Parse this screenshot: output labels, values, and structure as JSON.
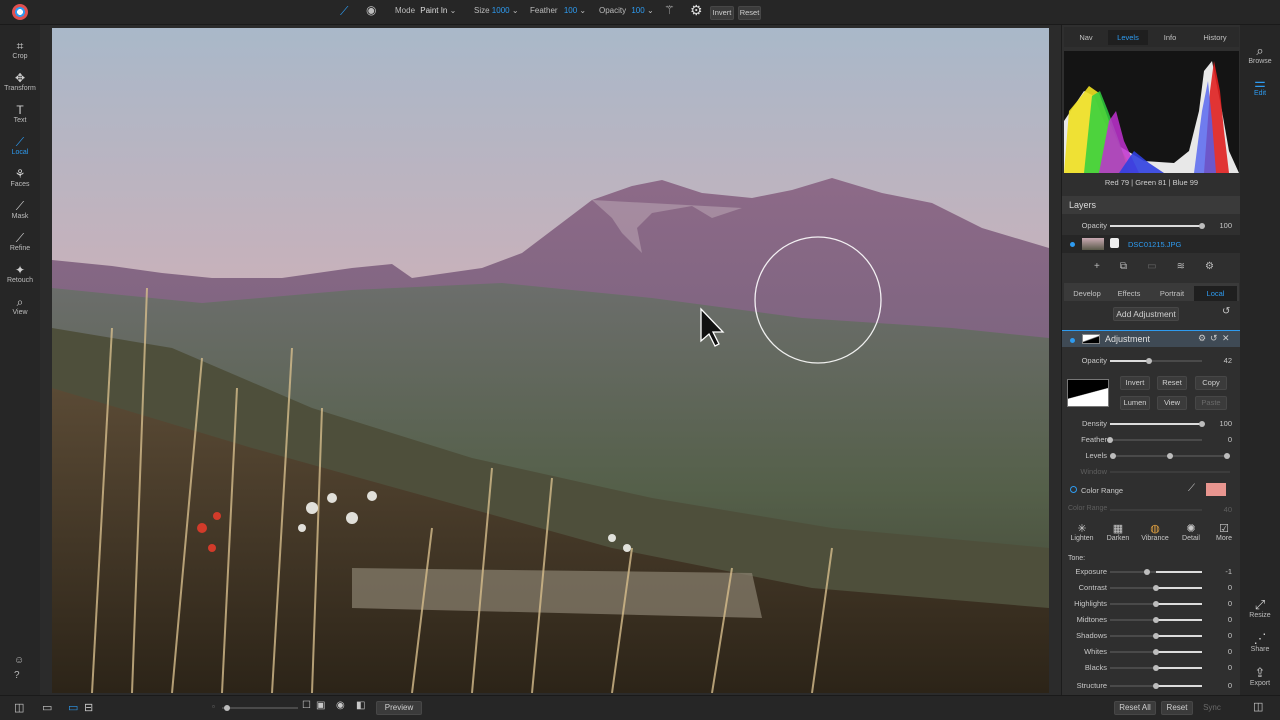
{
  "toolbar": {
    "mode_label": "Mode",
    "mode_value": "Paint In",
    "size_label": "Size",
    "size_value": "1000",
    "feather_label": "Feather",
    "feather_value": "100",
    "opacity_label": "Opacity",
    "opacity_value": "100",
    "invert": "Invert",
    "reset": "Reset"
  },
  "left_tools": [
    {
      "label": "Crop",
      "icon": "crop-icon"
    },
    {
      "label": "Transform",
      "icon": "transform-icon"
    },
    {
      "label": "Text",
      "icon": "text-icon"
    },
    {
      "label": "Local",
      "icon": "brush-icon"
    },
    {
      "label": "Faces",
      "icon": "faces-icon"
    },
    {
      "label": "Mask",
      "icon": "mask-icon"
    },
    {
      "label": "Refine",
      "icon": "refine-icon"
    },
    {
      "label": "Retouch",
      "icon": "retouch-icon"
    },
    {
      "label": "View",
      "icon": "zoom-icon"
    }
  ],
  "right_tools": {
    "browse": "Browse",
    "edit": "Edit",
    "resize": "Resize",
    "share": "Share",
    "export": "Export"
  },
  "panel": {
    "tabs": [
      "Nav",
      "Levels",
      "Info",
      "History"
    ],
    "histogram_readout": {
      "red_label": "Red",
      "red": "79",
      "green_label": "Green",
      "green": "81",
      "blue_label": "Blue",
      "blue": "99"
    },
    "layers_title": "Layers",
    "layer_opacity_label": "Opacity",
    "layer_opacity_value": "100",
    "layer_opacity_level": 1.0,
    "layer_name": "DSC01215.JPG",
    "module_tabs": [
      "Develop",
      "Effects",
      "Portrait",
      "Local"
    ],
    "add_adjustment": "Add Adjustment",
    "adjustment_title": "Adjustment",
    "adj_opacity_label": "Opacity",
    "adj_opacity_value": "42",
    "adj_opacity_level": 0.42,
    "mask_buttons": [
      "Invert",
      "Reset",
      "Copy",
      "Lumen",
      "View",
      "Paste"
    ],
    "mask_sliders": [
      {
        "label": "Density",
        "value": "100",
        "level": 1.0
      },
      {
        "label": "Feather",
        "value": "0",
        "level": 0.0
      },
      {
        "label": "Levels",
        "value": "",
        "level": 0.5
      },
      {
        "label": "Window",
        "value": "",
        "level": 0.0
      }
    ],
    "color_range_label": "Color Range",
    "color_range_swatch": "#e8958f",
    "color_range_slider_label": "Color Range",
    "color_range_slider_value": "40",
    "presets": [
      "Lighten",
      "Darken",
      "Vibrance",
      "Detail",
      "More"
    ],
    "tone_label": "Tone:",
    "tone_sliders": [
      {
        "label": "Exposure",
        "value": "-1"
      },
      {
        "label": "Contrast",
        "value": "0"
      },
      {
        "label": "Highlights",
        "value": "0"
      },
      {
        "label": "Midtones",
        "value": "0"
      },
      {
        "label": "Shadows",
        "value": "0"
      },
      {
        "label": "Whites",
        "value": "0"
      },
      {
        "label": "Blacks",
        "value": "0"
      },
      {
        "label": "Structure",
        "value": "0"
      }
    ]
  },
  "bottom": {
    "preview": "Preview",
    "reset_all": "Reset All",
    "reset": "Reset",
    "sync": "Sync"
  },
  "colors": {
    "accent": "#2e9bf0"
  }
}
